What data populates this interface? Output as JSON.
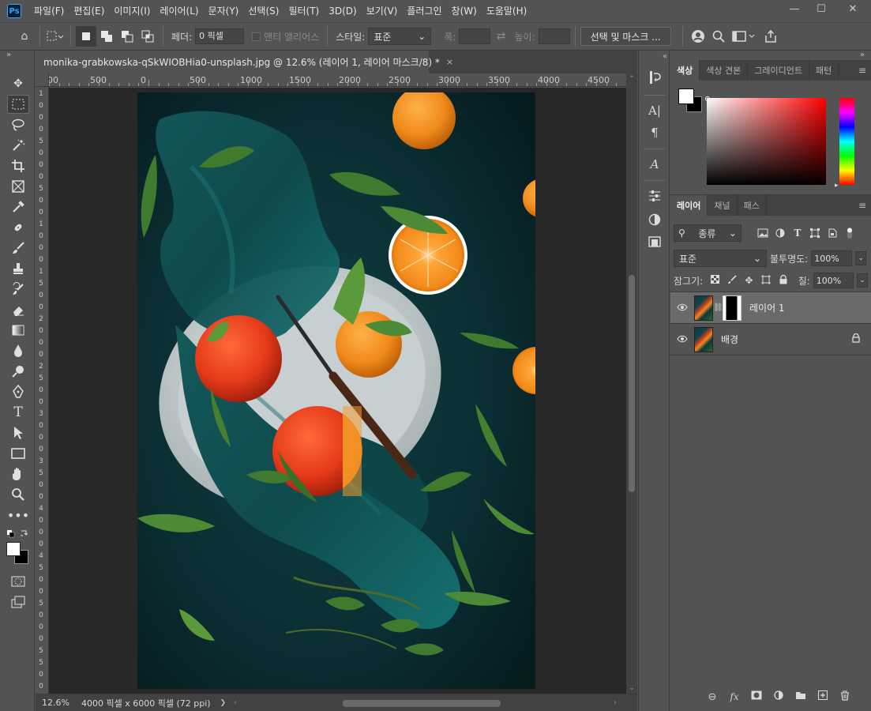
{
  "app": {
    "logo": "Ps"
  },
  "menubar": {
    "items": [
      "파일(F)",
      "편집(E)",
      "이미지(I)",
      "레이어(L)",
      "문자(Y)",
      "선택(S)",
      "필터(T)",
      "3D(D)",
      "보기(V)",
      "플러그인",
      "창(W)",
      "도움말(H)"
    ]
  },
  "window": {
    "minimize": "—",
    "maximize": "☐",
    "close": "✕"
  },
  "options": {
    "home_icon": "⌂",
    "feather_label": "페더:",
    "feather_value": "0 픽셀",
    "antialias_label": "앤티 앨리어스",
    "style_label": "스타일:",
    "style_value": "표준",
    "width_label": "폭:",
    "height_label": "높이:",
    "select_mask_button": "선택 및 마스크 ..."
  },
  "document": {
    "tab_title": "monika-grabkowska-qSkWIOBHia0-unsplash.jpg @ 12.6% (레이어 1, 레이어 마스크/8) *",
    "tab_close": "×",
    "zoom": "12.6%",
    "doc_info": "4000 픽셀 x 6000 픽셀 (72 ppi)",
    "status_arrow": "❯"
  },
  "rulers": {
    "top_labels": [
      "1000",
      "500",
      "0",
      "500",
      "1000",
      "1500",
      "2000",
      "2500",
      "3000",
      "3500",
      "4000",
      "4500"
    ],
    "left_labels": [
      "1",
      "0",
      "0",
      "0",
      "5",
      "0",
      "0",
      "0",
      "5",
      "0",
      "0",
      "1",
      "0",
      "0",
      "0",
      "1",
      "5",
      "0",
      "0",
      "2",
      "0",
      "0",
      "0",
      "2",
      "5",
      "0",
      "0",
      "3",
      "0",
      "0",
      "0",
      "3",
      "5",
      "0",
      "0",
      "4",
      "0",
      "0",
      "0",
      "4",
      "5",
      "0",
      "0",
      "5",
      "0",
      "0",
      "0",
      "5",
      "5",
      "0",
      "0"
    ]
  },
  "color_panel": {
    "tabs": [
      "색상",
      "색상 견본",
      "그레이디언트",
      "패턴"
    ],
    "foreground": "#ffffff",
    "background": "#000000"
  },
  "layers_panel": {
    "tabs": [
      "레이어",
      "채널",
      "패스"
    ],
    "filter_kind": "종류",
    "blend_mode": "표준",
    "opacity_label": "불투명도:",
    "opacity_value": "100%",
    "lock_label": "잠그기:",
    "fill_label": "칠:",
    "fill_value": "100%",
    "layers": [
      {
        "name": "레이어 1",
        "has_mask": true,
        "selected": true,
        "locked": false
      },
      {
        "name": "배경",
        "has_mask": false,
        "selected": false,
        "locked": true
      }
    ]
  },
  "colors": {
    "ui_bg": "#535353",
    "ui_dark": "#424242",
    "canvas_bg": "#282828",
    "ps_accent": "#31a8ff"
  }
}
